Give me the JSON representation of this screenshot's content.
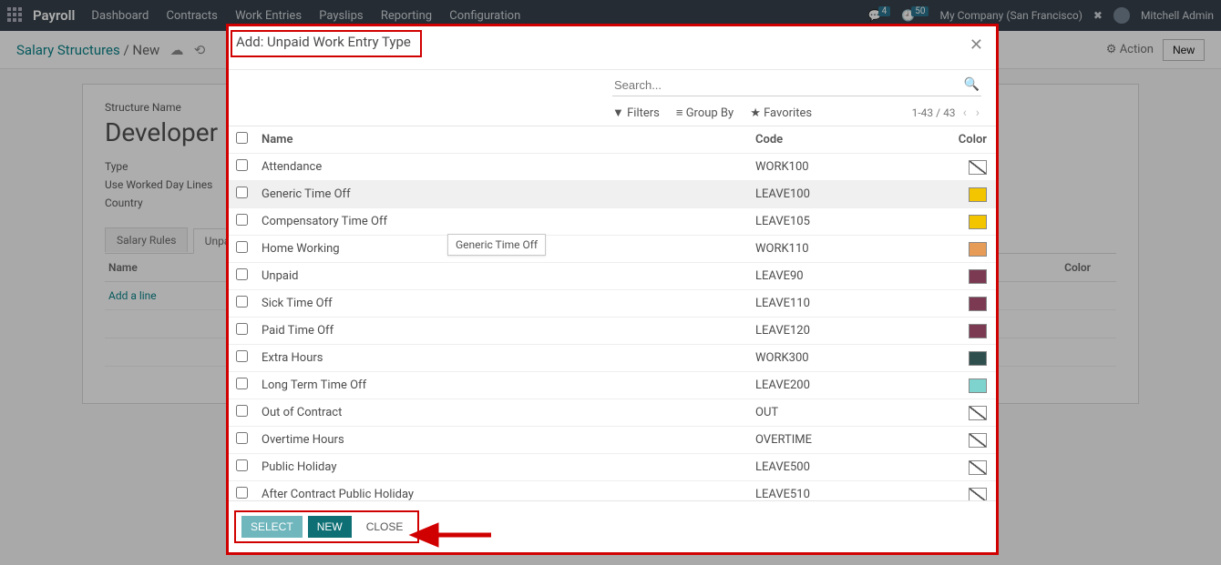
{
  "topbar": {
    "brand": "Payroll",
    "menu": [
      "Dashboard",
      "Contracts",
      "Work Entries",
      "Payslips",
      "Reporting",
      "Configuration"
    ],
    "badge1": "4",
    "badge2": "50",
    "company": "My Company (San Francisco)",
    "user": "Mitchell Admin"
  },
  "breadcrumb": {
    "root": "Salary Structures",
    "current": "New",
    "action_label": "Action",
    "new_label": "New"
  },
  "form": {
    "structure_label": "Structure Name",
    "structure_value": "Developer",
    "type_label": "Type",
    "worked_label": "Use Worked Day Lines",
    "country_label": "Country",
    "tab1": "Salary Rules",
    "tab2": "Unpaid",
    "col_name": "Name",
    "col_color": "Color",
    "add_line": "Add a line"
  },
  "modal": {
    "title": "Add: Unpaid Work Entry Type",
    "search_placeholder": "Search...",
    "filters": "Filters",
    "groupby": "Group By",
    "favorites": "Favorites",
    "pager": "1-43 / 43",
    "col_name": "Name",
    "col_code": "Code",
    "col_color": "Color",
    "tooltip": "Generic Time Off",
    "rows": [
      {
        "name": "Attendance",
        "code": "WORK100",
        "color": "slash"
      },
      {
        "name": "Generic Time Off",
        "code": "LEAVE100",
        "color": "#f2c500"
      },
      {
        "name": "Compensatory Time Off",
        "code": "LEAVE105",
        "color": "#f2c500"
      },
      {
        "name": "Home Working",
        "code": "WORK110",
        "color": "#e69c57"
      },
      {
        "name": "Unpaid",
        "code": "LEAVE90",
        "color": "#7b3a52"
      },
      {
        "name": "Sick Time Off",
        "code": "LEAVE110",
        "color": "#7b3a52"
      },
      {
        "name": "Paid Time Off",
        "code": "LEAVE120",
        "color": "#7b3a52"
      },
      {
        "name": "Extra Hours",
        "code": "WORK300",
        "color": "#2f4f4f"
      },
      {
        "name": "Long Term Time Off",
        "code": "LEAVE200",
        "color": "#7fd3cf"
      },
      {
        "name": "Out of Contract",
        "code": "OUT",
        "color": "slash"
      },
      {
        "name": "Overtime Hours",
        "code": "OVERTIME",
        "color": "slash"
      },
      {
        "name": "Public Holiday",
        "code": "LEAVE500",
        "color": "slash"
      },
      {
        "name": "After Contract Public Holiday",
        "code": "LEAVE510",
        "color": "slash"
      }
    ],
    "btn_select": "Select",
    "btn_new": "New",
    "btn_close": "Close"
  }
}
